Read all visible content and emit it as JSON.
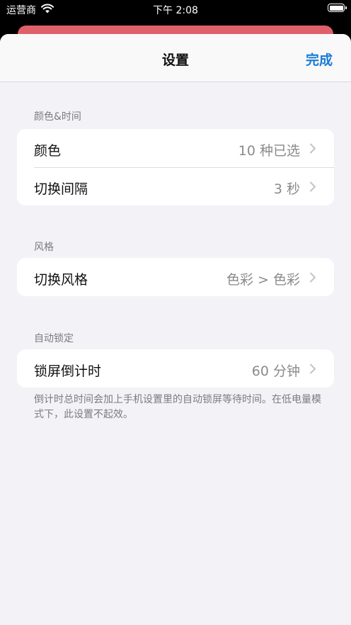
{
  "status_bar": {
    "carrier": "运营商",
    "time": "下午 2:08"
  },
  "nav": {
    "title": "设置",
    "done_label": "完成"
  },
  "sections": [
    {
      "header": "颜色&时间",
      "rows": [
        {
          "label": "颜色",
          "value": "10 种已选"
        },
        {
          "label": "切换间隔",
          "value": "3 秒"
        }
      ]
    },
    {
      "header": "风格",
      "rows": [
        {
          "label": "切换风格",
          "value": "色彩 > 色彩"
        }
      ]
    },
    {
      "header": "自动锁定",
      "rows": [
        {
          "label": "锁屏倒计时",
          "value": "60 分钟"
        }
      ],
      "footer": "倒计时总时间会加上手机设置里的自动锁屏等待时间。在低电量模式下，此设置不起效。"
    }
  ],
  "icons": {
    "wifi": "wifi-icon",
    "battery": "battery-icon",
    "chevron": "chevron-right-icon"
  },
  "colors": {
    "accent": "#1a7bd6",
    "background": "#f2f2f7",
    "secondary_text": "#8a8a8e",
    "behind_sheet": "#e0606a"
  }
}
